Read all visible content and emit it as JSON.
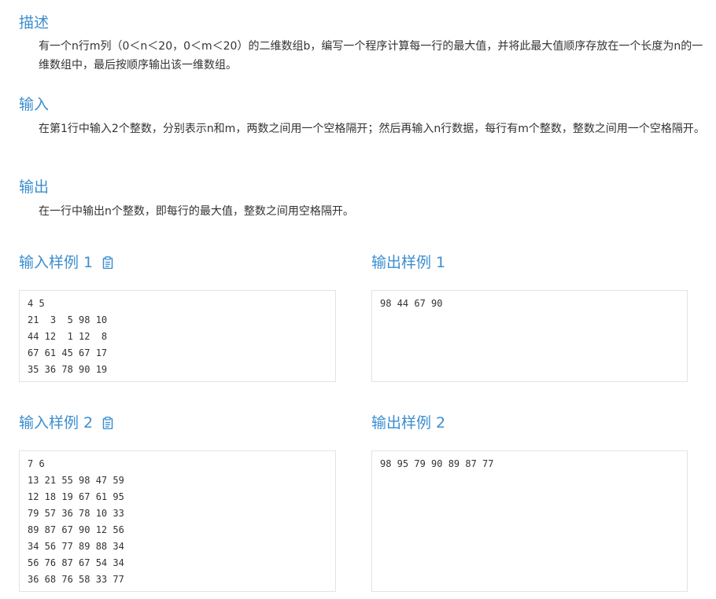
{
  "description": {
    "title": "描述",
    "text": "有一个n行m列（0＜n＜20，0＜m＜20）的二维数组b，编写一个程序计算每一行的最大值，并将此最大值顺序存放在一个长度为n的一维数组中，最后按顺序输出该一维数组。"
  },
  "input": {
    "title": "输入",
    "text": "在第1行中输入2个整数，分别表示n和m，两数之间用一个空格隔开；然后再输入n行数据，每行有m个整数，整数之间用一个空格隔开。"
  },
  "output": {
    "title": "输出",
    "text": "在一行中输出n个整数，即每行的最大值，整数之间用空格隔开。"
  },
  "samples": [
    {
      "input_title": "输入样例 1",
      "input_text": "4 5\n21  3  5 98 10\n44 12  1 12  8\n67 61 45 67 17\n35 36 78 90 19",
      "output_title": "输出样例 1",
      "output_text": "98 44 67 90"
    },
    {
      "input_title": "输入样例 2",
      "input_text": "7 6\n13 21 55 98 47 59\n12 18 19 67 61 95\n79 57 36 78 10 33\n89 87 67 90 12 56\n34 56 77 89 88 34\n56 76 87 67 54 34\n36 68 76 58 33 77",
      "output_title": "输出样例 2",
      "output_text": "98 95 79 90 89 87 77"
    }
  ],
  "icons": {
    "copy": "clipboard-icon"
  },
  "colors": {
    "heading": "#3b8ed0",
    "text": "#333333",
    "border": "#e3e3e3"
  }
}
